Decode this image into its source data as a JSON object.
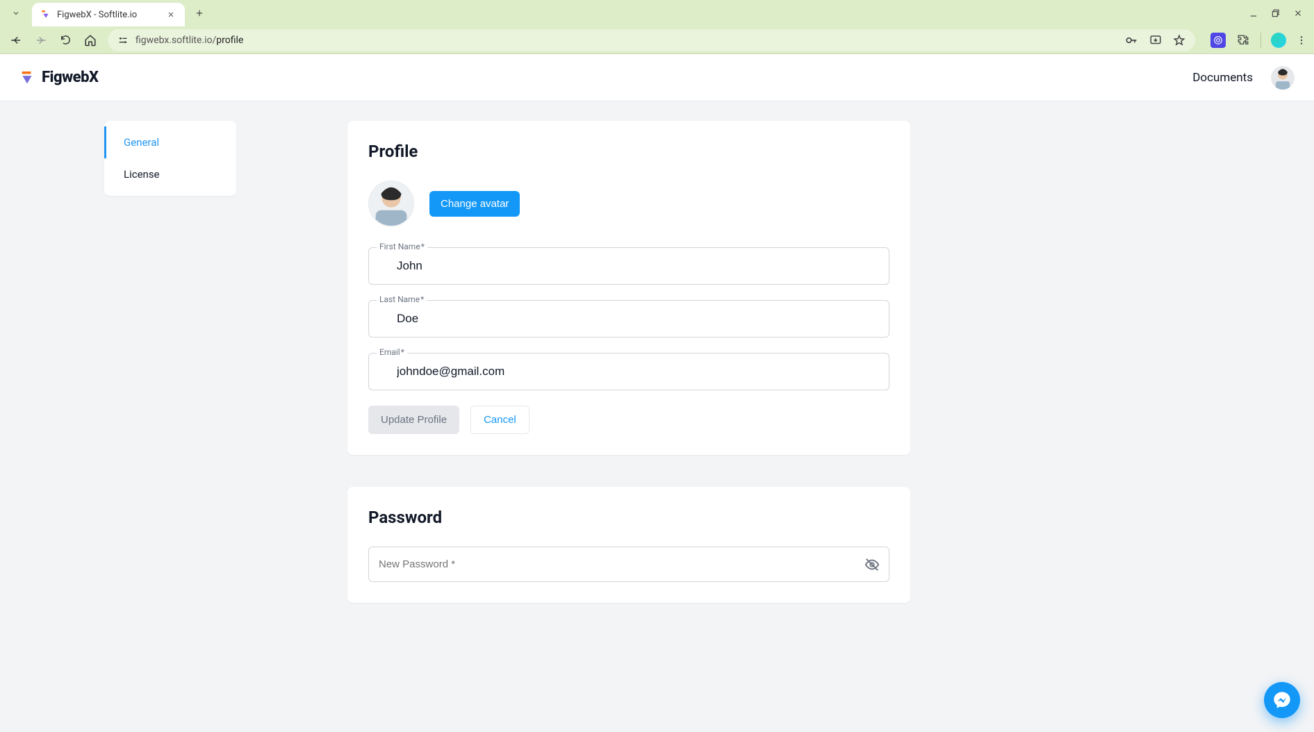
{
  "browser": {
    "tab_title": "FigwebX - Softlite.io",
    "url_prefix": "figwebx.softlite.io/",
    "url_path": "profile"
  },
  "header": {
    "brand": "FigwebX",
    "nav_documents": "Documents"
  },
  "sidebar": {
    "items": [
      {
        "label": "General",
        "active": true
      },
      {
        "label": "License",
        "active": false
      }
    ]
  },
  "profile": {
    "title": "Profile",
    "change_avatar": "Change avatar",
    "first_name_label": "First Name",
    "first_name_value": "John",
    "last_name_label": "Last Name",
    "last_name_value": "Doe",
    "email_label": "Email",
    "email_value": "johndoe@gmail.com",
    "update_button": "Update Profile",
    "cancel_button": "Cancel",
    "required_mark": "*"
  },
  "password": {
    "title": "Password",
    "new_password_label": "New Password *"
  }
}
